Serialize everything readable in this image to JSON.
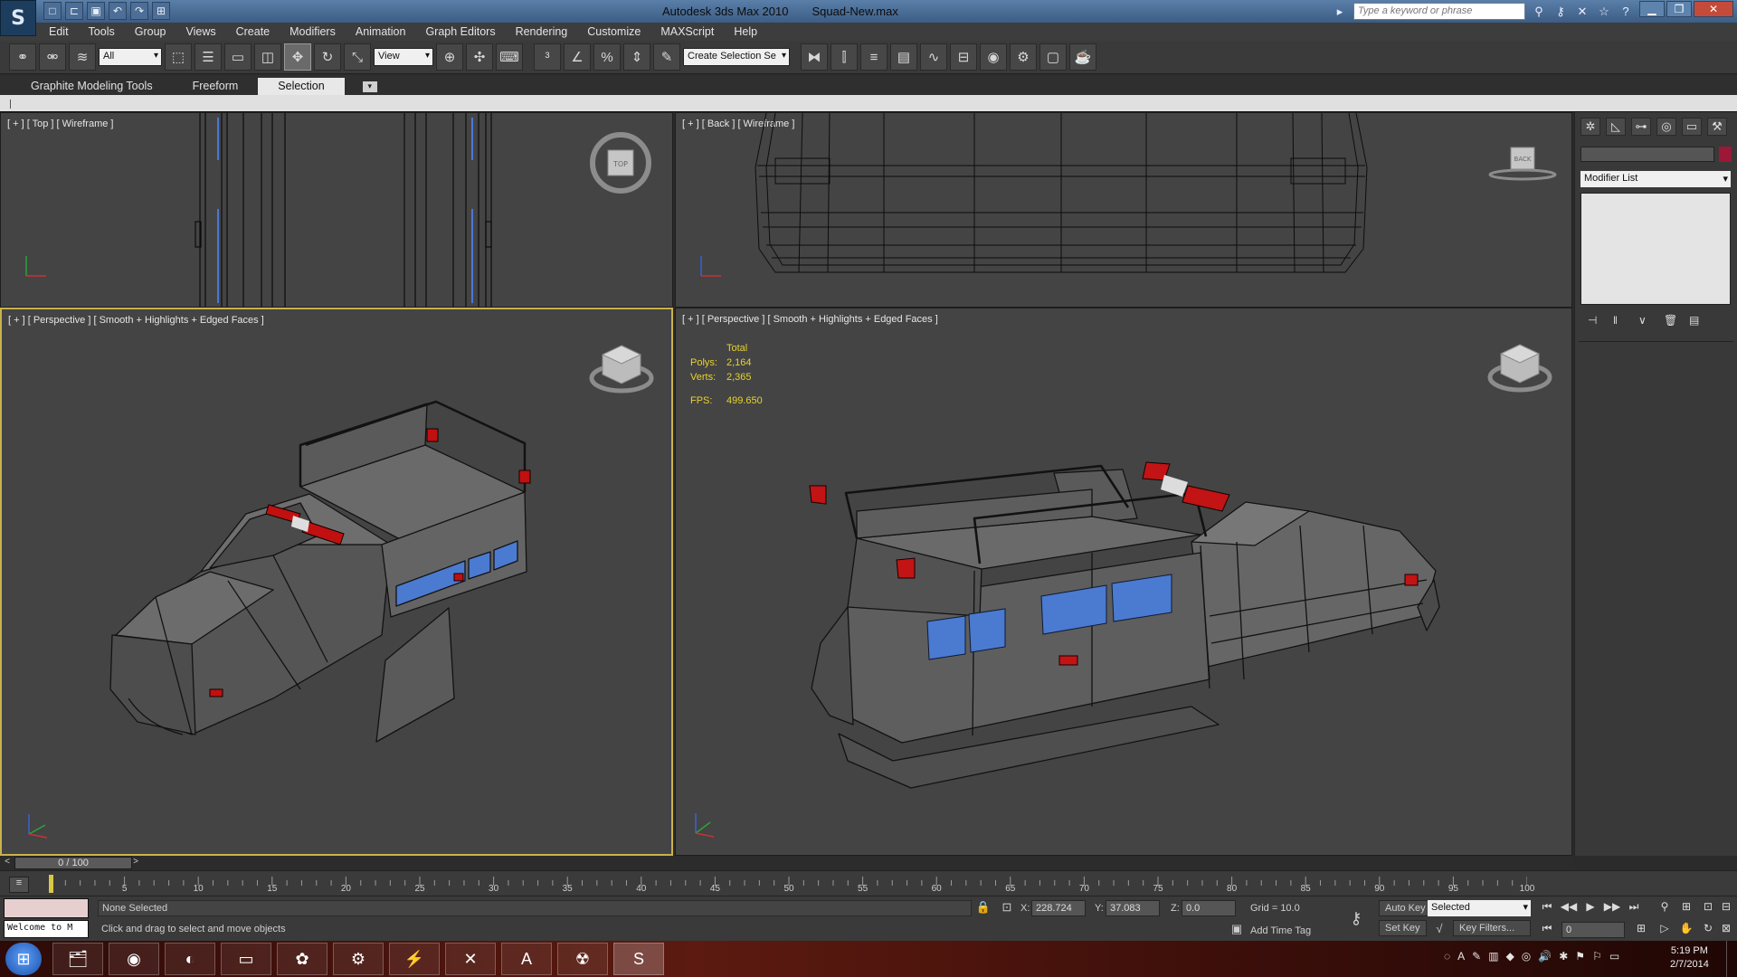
{
  "app": {
    "logo": "S",
    "name": "Autodesk 3ds Max  2010",
    "file": "Squad-New.max"
  },
  "quick_access": [
    "new-file-icon",
    "open-icon",
    "save-icon",
    "undo-icon",
    "redo-icon",
    "project-icon"
  ],
  "infocenter": {
    "search_placeholder": "Type a keyword or phrase"
  },
  "menus": [
    "Edit",
    "Tools",
    "Group",
    "Views",
    "Create",
    "Modifiers",
    "Animation",
    "Graph Editors",
    "Rendering",
    "Customize",
    "MAXScript",
    "Help"
  ],
  "toolbar": {
    "selection_filter": "All",
    "ref_coord": "View",
    "named_selection_placeholder": "Create Selection Se"
  },
  "ribbon": {
    "tabs": [
      "Graphite Modeling Tools",
      "Freeform",
      "Selection"
    ],
    "active_tab": "Selection"
  },
  "viewports": {
    "top": {
      "label": "[ + ] [ Top ] [ Wireframe ]",
      "cube": "TOP"
    },
    "back": {
      "label": "[ + ] [ Back ] [ Wireframe ]",
      "cube": "BACK"
    },
    "persp_left": {
      "label": "[ + ] [ Perspective ] [ Smooth + Highlights + Edged Faces ]"
    },
    "persp_right": {
      "label": "[ + ] [ Perspective ] [ Smooth + Highlights + Edged Faces ]",
      "stats": {
        "total": "Total",
        "polys_label": "Polys:",
        "polys": "2,164",
        "verts_label": "Verts:",
        "verts": "2,365",
        "fps_label": "FPS:",
        "fps": "499.650"
      }
    }
  },
  "command_panel": {
    "modifier_list": "Modifier List",
    "object_color": "#9c1836"
  },
  "timeline": {
    "slider": "0 / 100",
    "ticks": [
      "5",
      "10",
      "15",
      "20",
      "25",
      "30",
      "35",
      "40",
      "45",
      "50",
      "55",
      "60",
      "65",
      "70",
      "75",
      "80",
      "85",
      "90",
      "95",
      "100"
    ]
  },
  "status": {
    "listener": "Welcome to M",
    "selection": "None Selected",
    "prompt": "Click and drag to select and move objects",
    "x_label": "X:",
    "x": "228.724",
    "y_label": "Y:",
    "y": "37.083",
    "z_label": "Z:",
    "z": "0.0",
    "grid": "Grid = 10.0",
    "add_time_tag": "Add Time Tag",
    "auto_key": "Auto Key",
    "set_key": "Set Key",
    "key_mode": "Selected",
    "key_filters": "Key Filters...",
    "frame": "0"
  },
  "taskbar": {
    "apps": [
      "file-explorer-icon",
      "chrome-icon",
      "media-player-icon",
      "folder-icon",
      "settings-icon",
      "steam-icon",
      "thunder-icon",
      "x-app-icon",
      "acrobat-icon",
      "game-icon",
      "3dsmax-icon"
    ],
    "clock_time": "5:19 PM",
    "clock_date": "2/7/2014"
  },
  "colors": {
    "accent_active_viewport": "#c9b24c",
    "stats_text": "#e6d22e",
    "window_glass": "#ff3322"
  }
}
